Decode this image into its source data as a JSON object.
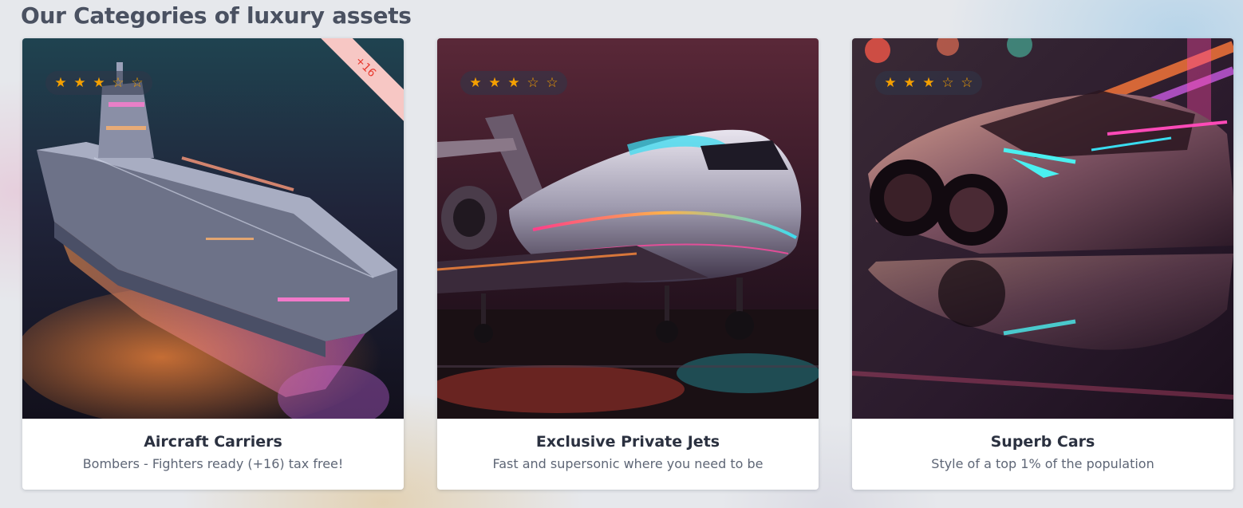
{
  "section": {
    "title": "Our Categories of luxury assets"
  },
  "rating_icons": [
    "star-filled-icon",
    "star-filled-icon",
    "star-filled-icon",
    "star-outline-icon",
    "star-outline-icon"
  ],
  "cards": [
    {
      "title": "Aircraft Carriers",
      "description": "Bombers - Fighters ready (+16) tax free!",
      "rating": 3,
      "max_rating": 5,
      "badge": "+16",
      "image_subject": "aircraft-carrier-image"
    },
    {
      "title": "Exclusive Private Jets",
      "description": "Fast and supersonic where you need to be",
      "rating": 3,
      "max_rating": 5,
      "image_subject": "private-jet-image"
    },
    {
      "title": "Superb Cars",
      "description": "Style of a top 1% of the population",
      "rating": 3,
      "max_rating": 5,
      "image_subject": "sports-car-image"
    }
  ],
  "colors": {
    "star": "#f5a000",
    "badge_background": "#f7c7c4",
    "badge_text": "#e8392e",
    "title_text": "#2b3140",
    "description_text": "#5e6676",
    "heading_text": "#4a5161"
  }
}
